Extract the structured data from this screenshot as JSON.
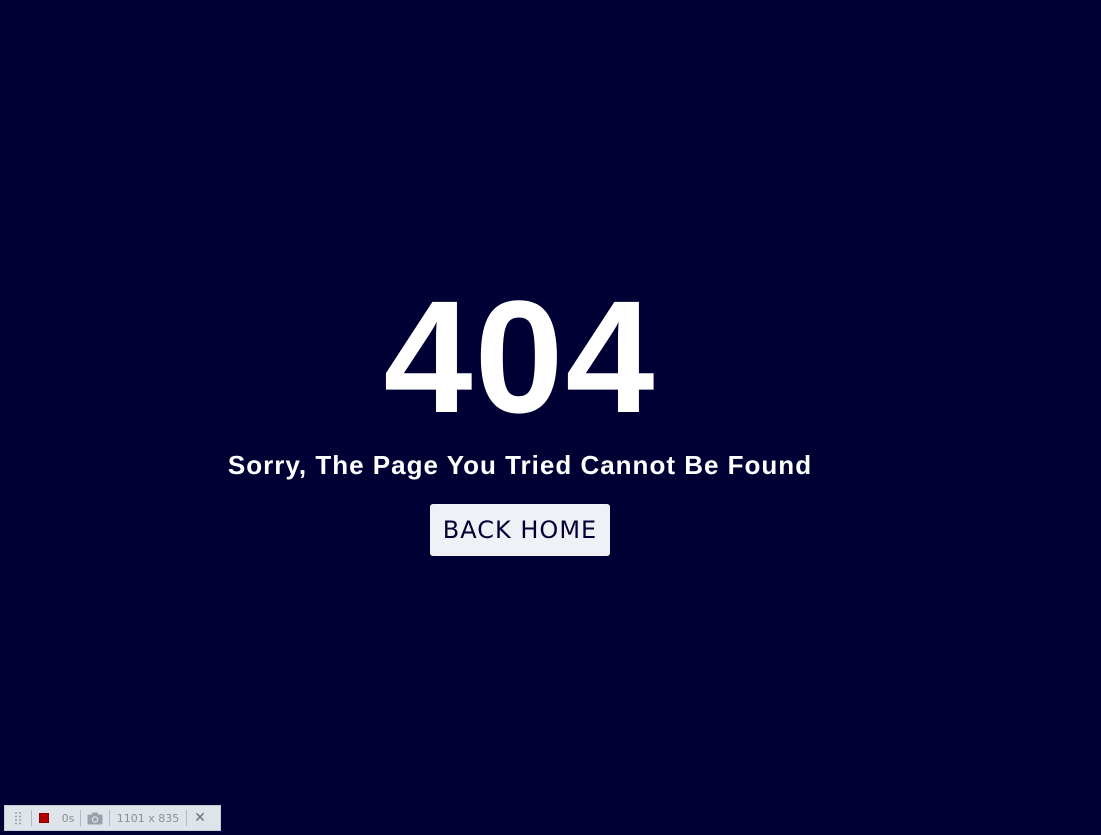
{
  "error": {
    "code": "404",
    "message": "Sorry, The Page You Tried Cannot Be Found",
    "back_button_label": "BACK HOME"
  },
  "recorder": {
    "timer": "0s",
    "dimensions": "1101 x 835",
    "close_glyph": "✕"
  },
  "colors": {
    "background": "#000035",
    "text": "#ffffff",
    "button_bg": "#f0f0f7",
    "button_text": "#000035",
    "record_stop": "#b30000"
  },
  "icons": {
    "drag": "drag-handle-icon",
    "stop": "stop-record-icon",
    "camera": "camera-icon",
    "close": "close-icon"
  }
}
